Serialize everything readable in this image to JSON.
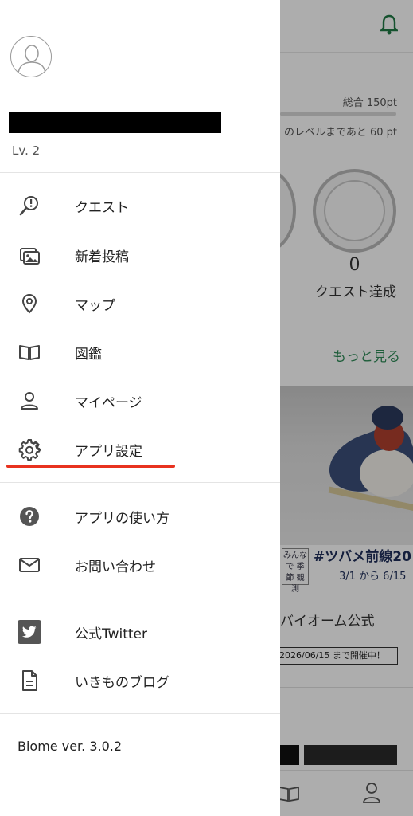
{
  "background": {
    "points_total": "総合 150pt",
    "points_next": "のレベルまであと 60 pt",
    "badge_count": "0",
    "badge_label": "クエスト達成",
    "more_link": "もっと見る",
    "season_box": "みんなで 季節 観測",
    "event_hashtag": "#ツバメ前線20",
    "event_dates": "3/1 から 6/15",
    "event_title": "バイオーム公式",
    "event_status": "2026/06/15 まで開催中！",
    "accent_color": "#2e8b57"
  },
  "drawer": {
    "user_name": "",
    "level": "Lv. 2",
    "menu_main": [
      {
        "label": "クエスト",
        "icon": "quest-search-icon"
      },
      {
        "label": "新着投稿",
        "icon": "photos-icon"
      },
      {
        "label": "マップ",
        "icon": "map-pin-icon"
      },
      {
        "label": "図鑑",
        "icon": "book-icon"
      },
      {
        "label": "マイページ",
        "icon": "person-icon"
      },
      {
        "label": "アプリ設定",
        "icon": "gear-icon"
      }
    ],
    "menu_help": [
      {
        "label": "アプリの使い方",
        "icon": "help-icon"
      },
      {
        "label": "お問い合わせ",
        "icon": "mail-icon"
      }
    ],
    "menu_links": [
      {
        "label": "公式Twitter",
        "icon": "twitter-icon"
      },
      {
        "label": "いきものブログ",
        "icon": "document-icon"
      }
    ],
    "version": "Biome ver. 3.0.2",
    "highlight_color": "#e8321f"
  }
}
